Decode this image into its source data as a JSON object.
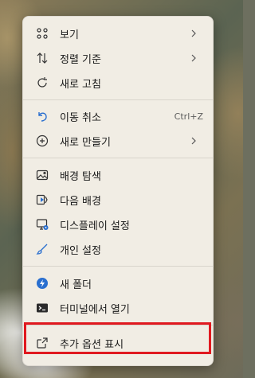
{
  "colors": {
    "menu_bg": "#f1ede4",
    "text": "#1a1a1a",
    "muted_text": "#5c5c5c",
    "accent_blue": "#2a6fcf",
    "highlight_red": "#e0191f"
  },
  "menu": {
    "items": [
      {
        "label": "보기",
        "icon": "grid-view-icon",
        "submenu": true
      },
      {
        "label": "정렬 기준",
        "icon": "sort-arrows-icon",
        "submenu": true
      },
      {
        "label": "새로 고침",
        "icon": "refresh-icon",
        "submenu": false
      },
      {
        "label": "이동 취소",
        "icon": "undo-icon",
        "shortcut": "Ctrl+Z"
      },
      {
        "label": "새로 만들기",
        "icon": "add-circle-icon",
        "submenu": true
      },
      {
        "label": "배경 탐색",
        "icon": "image-icon"
      },
      {
        "label": "다음 배경",
        "icon": "next-background-icon"
      },
      {
        "label": "디스플레이 설정",
        "icon": "display-settings-icon"
      },
      {
        "label": "개인 설정",
        "icon": "brush-icon"
      },
      {
        "label": "새 폴더",
        "icon": "new-folder-icon"
      },
      {
        "label": "터미널에서 열기",
        "icon": "terminal-icon"
      },
      {
        "label": "추가 옵션 표시",
        "icon": "show-more-options-icon",
        "highlighted": true
      }
    ]
  }
}
